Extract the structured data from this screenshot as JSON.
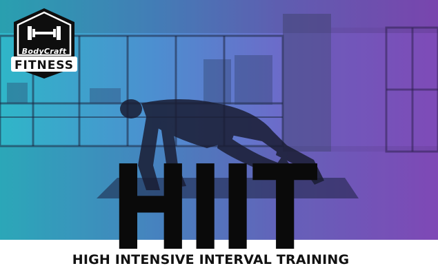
{
  "logo": {
    "brand": "BodyCraft",
    "word": "FITNESS"
  },
  "headline": "HIIT",
  "subtitle": "HIGH INTENSIVE INTERVAL TRAINING",
  "colors": {
    "gradient_start": "#2fb6c8",
    "gradient_end": "#8a4fc6",
    "text": "#111111"
  },
  "icons": [
    "dumbbell-icon"
  ]
}
